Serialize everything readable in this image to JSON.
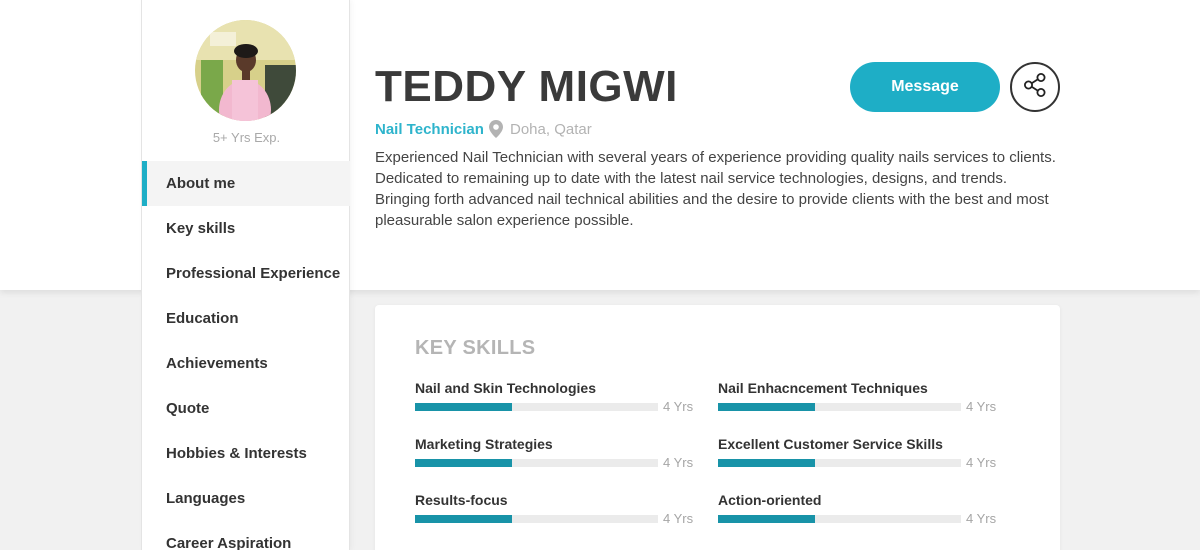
{
  "profile": {
    "name": "TEDDY MIGWI",
    "role": "Nail Technician",
    "location": "Doha, Qatar",
    "experience": "5+ Yrs Exp.",
    "bio": "Experienced Nail Technician with several years of experience providing quality nails services to clients. Dedicated to remaining up to date with the latest nail service technologies, designs, and trends. Bringing forth advanced nail technical abilities and the desire to provide clients with the best and most pleasurable salon experience possible."
  },
  "actions": {
    "message_label": "Message",
    "share_icon": "share-icon"
  },
  "nav": {
    "items": [
      {
        "label": "About me",
        "active": true
      },
      {
        "label": "Key skills"
      },
      {
        "label": "Professional Experience"
      },
      {
        "label": "Education"
      },
      {
        "label": "Achievements"
      },
      {
        "label": "Quote"
      },
      {
        "label": "Hobbies & Interests"
      },
      {
        "label": "Languages"
      },
      {
        "label": "Career Aspiration"
      }
    ]
  },
  "skills": {
    "title": "KEY SKILLS",
    "items": [
      {
        "name": "Nail and Skin Technologies",
        "years": "4 Yrs",
        "level": 0.4
      },
      {
        "name": "Nail Enhacncement Techniques",
        "years": "4 Yrs",
        "level": 0.4
      },
      {
        "name": "Marketing Strategies",
        "years": "4 Yrs",
        "level": 0.4
      },
      {
        "name": "Excellent Customer Service Skills",
        "years": "4 Yrs",
        "level": 0.4
      },
      {
        "name": "Results-focus",
        "years": "4 Yrs",
        "level": 0.4
      },
      {
        "name": "Action-oriented",
        "years": "4 Yrs",
        "level": 0.4
      }
    ]
  },
  "colors": {
    "accent": "#1eaec6",
    "bar_fill": "#1893a8",
    "bar_track": "#ebebeb"
  }
}
